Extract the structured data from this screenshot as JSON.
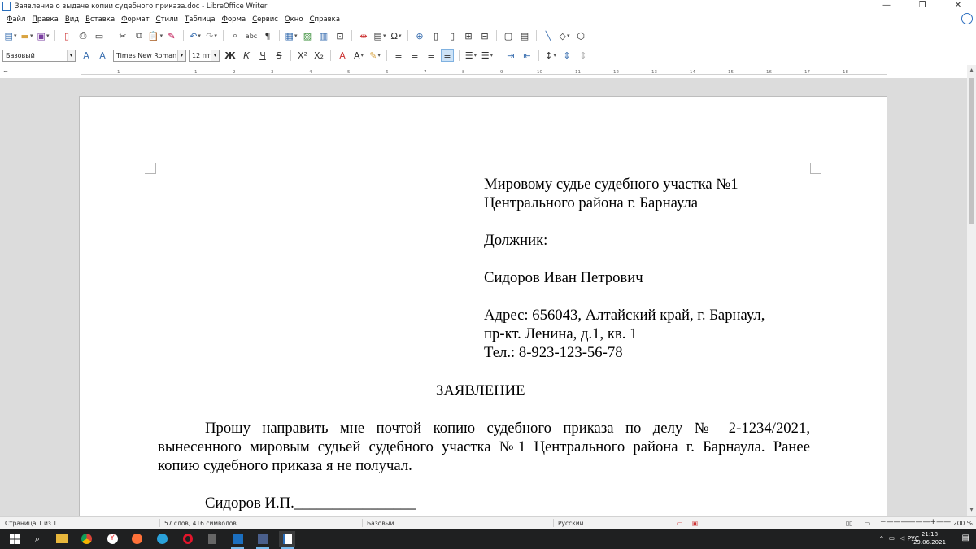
{
  "window": {
    "title": "Заявление о выдаче копии судебного приказа.doc - LibreOffice Writer",
    "minimize": "—",
    "restore": "❐",
    "close": "✕"
  },
  "menu": [
    "Файл",
    "Правка",
    "Вид",
    "Вставка",
    "Формат",
    "Стили",
    "Таблица",
    "Форма",
    "Сервис",
    "Окно",
    "Справка"
  ],
  "formatting": {
    "paragraph_style": "Базовый",
    "font_name": "Times New Roman",
    "font_size": "12 пт",
    "bold": "Ж",
    "italic": "К",
    "underline": "Ч",
    "strike": "S",
    "superscript": "X²",
    "subscript": "X₂"
  },
  "ruler": {
    "ticks": [
      "1",
      "1",
      "2",
      "3",
      "4",
      "5",
      "6",
      "7",
      "8",
      "9",
      "10",
      "11",
      "12",
      "13",
      "14",
      "15",
      "16",
      "17",
      "18"
    ]
  },
  "document": {
    "recipient": [
      "Мировому судье судебного участка №1",
      "Центрального района г. Барнаула",
      "",
      "Должник:",
      "",
      "Сидоров Иван Петрович",
      "",
      "Адрес: 656043, Алтайский край, г. Барнаул,",
      "пр-кт. Ленина, д.1, кв. 1",
      "Тел.: 8-923-123-56-78"
    ],
    "heading": "ЗАЯВЛЕНИЕ",
    "body_lines": [
      "Прошу направить мне почтой копию судебного приказа по делу № 2-1234/2021,",
      "вынесенного мировым судьей судебного участка №1 Центрального района г. Барнаула. Ранее",
      "копию судебного приказа я не получал."
    ],
    "signature": "Сидоров И.П.________________"
  },
  "status": {
    "page": "Страница 1 из 1",
    "words": "57 слов, 416 символов",
    "style": "Базовый",
    "language": "Русский",
    "zoom": "200 %"
  },
  "taskbar": {
    "language": "РУС",
    "time": "21:18",
    "date": "29.06.2021"
  },
  "colors": {
    "accent": "#2a6ebb",
    "taskbar": "#1f2021",
    "doc_background": "#dcdcdc"
  }
}
